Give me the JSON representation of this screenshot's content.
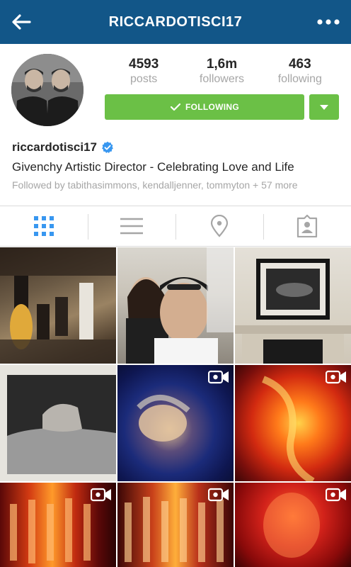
{
  "header": {
    "title": "RICCARDOTISCI17",
    "back_icon": "arrow-left-icon",
    "more_icon": "more-dots-icon",
    "bar_color": "#125688"
  },
  "profile": {
    "avatar_icon": "profile-avatar",
    "stats": [
      {
        "value": "4593",
        "label": "posts"
      },
      {
        "value": "1,6m",
        "label": "followers"
      },
      {
        "value": "463",
        "label": "following"
      }
    ],
    "follow_button_label": "FOLLOWING",
    "follow_button_color": "#6bc046",
    "username": "riccardotisci17",
    "verified": true,
    "bio": "Givenchy Artistic Director - Celebrating Love and Life",
    "followed_by": "Followed by tabithasimmons, kendalljenner, tommyton + 57 more"
  },
  "tabs": [
    {
      "icon": "grid-icon",
      "active": true
    },
    {
      "icon": "list-icon",
      "active": false
    },
    {
      "icon": "location-pin-icon",
      "active": false
    },
    {
      "icon": "tagged-photos-icon",
      "active": false
    }
  ],
  "grid": [
    {
      "type": "photo"
    },
    {
      "type": "photo"
    },
    {
      "type": "photo"
    },
    {
      "type": "photo"
    },
    {
      "type": "video"
    },
    {
      "type": "video"
    },
    {
      "type": "video"
    },
    {
      "type": "video"
    },
    {
      "type": "video"
    }
  ]
}
